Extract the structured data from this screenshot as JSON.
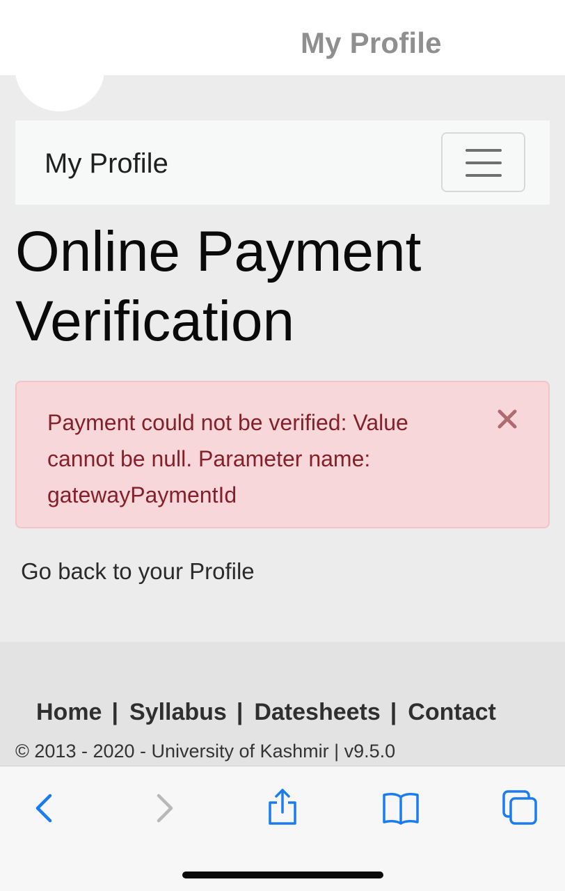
{
  "header": {
    "title": "My Profile"
  },
  "navbar": {
    "brand": "My Profile",
    "toggler_icon": "hamburger-menu-icon"
  },
  "page": {
    "title": "Online Payment Verification"
  },
  "alert": {
    "message": "Payment could not be verified: Value cannot be null. Parameter name: gatewayPaymentId",
    "close_icon": "close-icon",
    "color": "#842029",
    "background": "#f8d7da"
  },
  "back_link": "Go back to your Profile",
  "footer": {
    "links": [
      "Home",
      "Syllabus",
      "Datesheets",
      "Contact"
    ],
    "separator": "|",
    "copyright": "© 2013 - 2020 - University of Kashmir | v9.5.0"
  },
  "browser_toolbar": {
    "icons": [
      "back-icon",
      "forward-icon",
      "share-icon",
      "bookmarks-icon",
      "tabs-icon"
    ],
    "accent": "#1a7cf0"
  }
}
